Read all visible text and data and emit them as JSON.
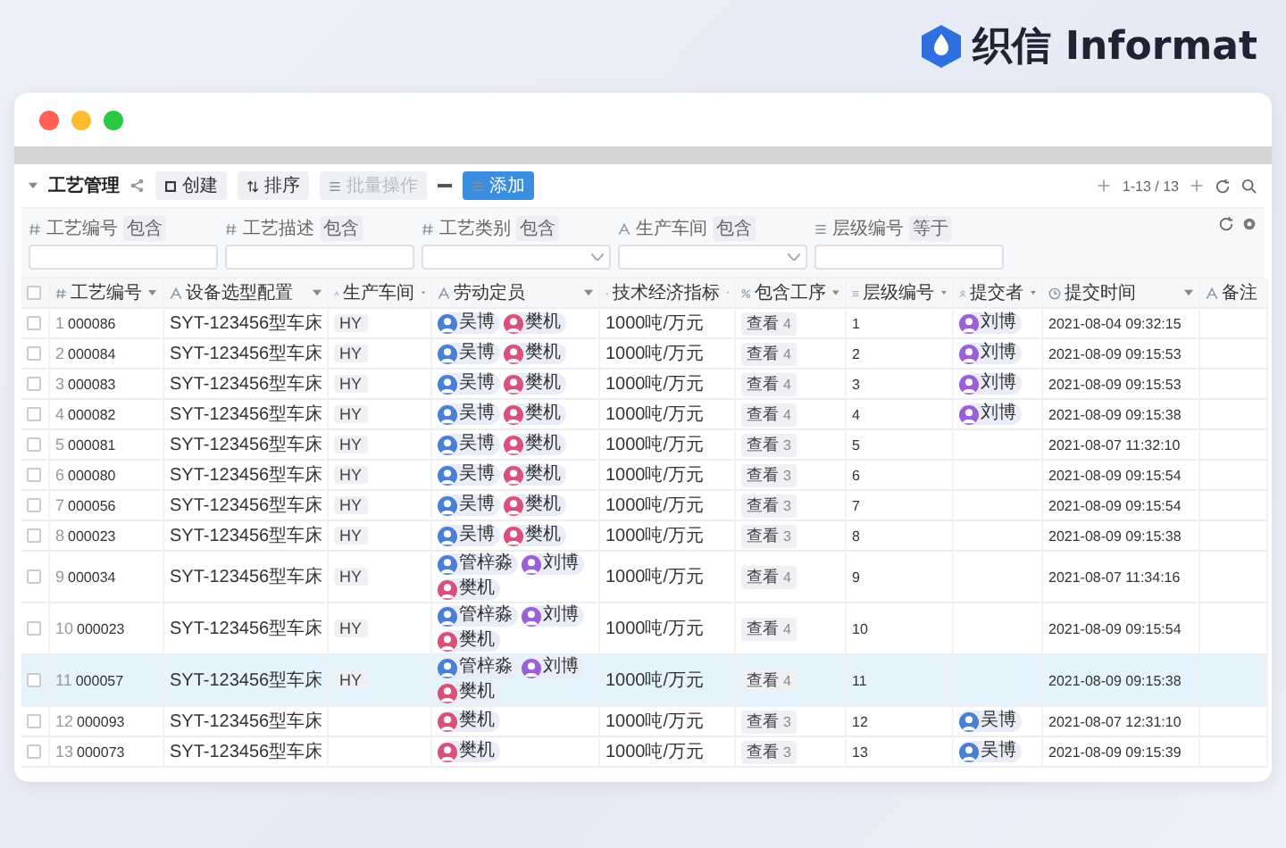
{
  "brand": {
    "name": "织信 Informat"
  },
  "toolbar": {
    "title": "工艺管理",
    "buttons": [
      {
        "label": "创建",
        "primary": false,
        "disabled": false
      },
      {
        "label": "排序",
        "primary": false,
        "disabled": false
      },
      {
        "label": "批量操作",
        "primary": false,
        "disabled": true
      },
      {
        "label": "添加",
        "primary": true,
        "disabled": false
      }
    ],
    "pagination": "1-13 / 13"
  },
  "filters": [
    {
      "label": "工艺编号",
      "op": "包含",
      "kind": "input"
    },
    {
      "label": "工艺描述",
      "op": "包含",
      "kind": "input"
    },
    {
      "label": "工艺类别",
      "op": "包含",
      "kind": "select"
    },
    {
      "label": "生产车间",
      "op": "包含",
      "kind": "select"
    },
    {
      "label": "层级编号",
      "op": "等于",
      "kind": "input"
    }
  ],
  "select_all": {
    "checked": false
  },
  "columns": [
    {
      "label": "工艺编号"
    },
    {
      "label": "设备选型配置"
    },
    {
      "label": "生产车间"
    },
    {
      "label": "劳动定员"
    },
    {
      "label": "技术经济指标"
    },
    {
      "label": "包含工序"
    },
    {
      "label": "层级编号"
    },
    {
      "label": "提交者"
    },
    {
      "label": "提交时间"
    },
    {
      "label": "备注"
    }
  ],
  "rows": [
    {
      "index": "1",
      "code": "000086",
      "config": "SYT-123456型车床",
      "workshop": "HY",
      "staff": [
        {
          "name": "吴博",
          "color": "#4a7fd6"
        },
        {
          "name": "樊机",
          "color": "#d9507a"
        }
      ],
      "indicator": "1000吨/万元",
      "process": "查看",
      "process_count": "4",
      "level": "1",
      "submitter": [
        {
          "name": "刘博",
          "color": "#9b5fd6"
        }
      ],
      "time": "2021-08-04 09:32:15",
      "checked": false,
      "selected": false
    },
    {
      "index": "2",
      "code": "000084",
      "config": "SYT-123456型车床",
      "workshop": "HY",
      "staff": [
        {
          "name": "吴博",
          "color": "#4a7fd6"
        },
        {
          "name": "樊机",
          "color": "#d9507a"
        }
      ],
      "indicator": "1000吨/万元",
      "process": "查看",
      "process_count": "4",
      "level": "2",
      "submitter": [
        {
          "name": "刘博",
          "color": "#9b5fd6"
        }
      ],
      "time": "2021-08-09 09:15:53",
      "checked": false,
      "selected": false
    },
    {
      "index": "3",
      "code": "000083",
      "config": "SYT-123456型车床",
      "workshop": "HY",
      "staff": [
        {
          "name": "吴博",
          "color": "#4a7fd6"
        },
        {
          "name": "樊机",
          "color": "#d9507a"
        }
      ],
      "indicator": "1000吨/万元",
      "process": "查看",
      "process_count": "4",
      "level": "3",
      "submitter": [
        {
          "name": "刘博",
          "color": "#9b5fd6"
        }
      ],
      "time": "2021-08-09 09:15:53",
      "checked": false,
      "selected": false
    },
    {
      "index": "4",
      "code": "000082",
      "config": "SYT-123456型车床",
      "workshop": "HY",
      "staff": [
        {
          "name": "吴博",
          "color": "#4a7fd6"
        },
        {
          "name": "樊机",
          "color": "#d9507a"
        }
      ],
      "indicator": "1000吨/万元",
      "process": "查看",
      "process_count": "4",
      "level": "4",
      "submitter": [
        {
          "name": "刘博",
          "color": "#9b5fd6"
        }
      ],
      "time": "2021-08-09 09:15:38",
      "checked": false,
      "selected": false
    },
    {
      "index": "5",
      "code": "000081",
      "config": "SYT-123456型车床",
      "workshop": "HY",
      "staff": [
        {
          "name": "吴博",
          "color": "#4a7fd6"
        },
        {
          "name": "樊机",
          "color": "#d9507a"
        }
      ],
      "indicator": "1000吨/万元",
      "process": "查看",
      "process_count": "3",
      "level": "5",
      "submitter": [],
      "time": "2021-08-07 11:32:10",
      "checked": false,
      "selected": false
    },
    {
      "index": "6",
      "code": "000080",
      "config": "SYT-123456型车床",
      "workshop": "HY",
      "staff": [
        {
          "name": "吴博",
          "color": "#4a7fd6"
        },
        {
          "name": "樊机",
          "color": "#d9507a"
        }
      ],
      "indicator": "1000吨/万元",
      "process": "查看",
      "process_count": "3",
      "level": "6",
      "submitter": [],
      "time": "2021-08-09 09:15:54",
      "checked": false,
      "selected": false
    },
    {
      "index": "7",
      "code": "000056",
      "config": "SYT-123456型车床",
      "workshop": "HY",
      "staff": [
        {
          "name": "吴博",
          "color": "#4a7fd6"
        },
        {
          "name": "樊机",
          "color": "#d9507a"
        }
      ],
      "indicator": "1000吨/万元",
      "process": "查看",
      "process_count": "3",
      "level": "7",
      "submitter": [],
      "time": "2021-08-09 09:15:54",
      "checked": false,
      "selected": false
    },
    {
      "index": "8",
      "code": "000023",
      "config": "SYT-123456型车床",
      "workshop": "HY",
      "staff": [
        {
          "name": "吴博",
          "color": "#4a7fd6"
        },
        {
          "name": "樊机",
          "color": "#d9507a"
        }
      ],
      "indicator": "1000吨/万元",
      "process": "查看",
      "process_count": "3",
      "level": "8",
      "submitter": [],
      "time": "2021-08-09 09:15:38",
      "checked": false,
      "selected": false
    },
    {
      "index": "9",
      "code": "000034",
      "config": "SYT-123456型车床",
      "workshop": "HY",
      "staff": [
        {
          "name": "管梓淼",
          "color": "#4a7fd6"
        },
        {
          "name": "刘博",
          "color": "#9b5fd6"
        },
        {
          "name": "樊机",
          "color": "#d9507a"
        }
      ],
      "indicator": "1000吨/万元",
      "process": "查看",
      "process_count": "4",
      "level": "9",
      "submitter": [],
      "time": "2021-08-07 11:34:16",
      "checked": false,
      "selected": false
    },
    {
      "index": "10",
      "code": "000023",
      "config": "SYT-123456型车床",
      "workshop": "HY",
      "staff": [
        {
          "name": "管梓淼",
          "color": "#4a7fd6"
        },
        {
          "name": "刘博",
          "color": "#9b5fd6"
        },
        {
          "name": "樊机",
          "color": "#d9507a"
        }
      ],
      "indicator": "1000吨/万元",
      "process": "查看",
      "process_count": "4",
      "level": "10",
      "submitter": [],
      "time": "2021-08-09 09:15:54",
      "checked": false,
      "selected": false
    },
    {
      "index": "11",
      "code": "000057",
      "config": "SYT-123456型车床",
      "workshop": "HY",
      "staff": [
        {
          "name": "管梓淼",
          "color": "#4a7fd6"
        },
        {
          "name": "刘博",
          "color": "#9b5fd6"
        },
        {
          "name": "樊机",
          "color": "#d9507a"
        }
      ],
      "indicator": "1000吨/万元",
      "process": "查看",
      "process_count": "4",
      "level": "11",
      "submitter": [],
      "time": "2021-08-09 09:15:38",
      "checked": false,
      "selected": true
    },
    {
      "index": "12",
      "code": "000093",
      "config": "SYT-123456型车床",
      "staff": [
        {
          "name": "樊机",
          "color": "#d9507a"
        }
      ],
      "indicator": "1000吨/万元",
      "process": "查看",
      "process_count": "3",
      "level": "12",
      "submitter": [
        {
          "name": "吴博",
          "color": "#4a7fd6"
        }
      ],
      "time": "2021-08-07 12:31:10",
      "checked": false,
      "selected": false
    },
    {
      "index": "13",
      "code": "000073",
      "config": "SYT-123456型车床",
      "staff": [
        {
          "name": "樊机",
          "color": "#d9507a"
        }
      ],
      "indicator": "1000吨/万元",
      "process": "查看",
      "process_count": "3",
      "level": "13",
      "submitter": [
        {
          "name": "吴博",
          "color": "#4a7fd6"
        }
      ],
      "time": "2021-08-09 09:15:39",
      "checked": false,
      "selected": false
    }
  ]
}
